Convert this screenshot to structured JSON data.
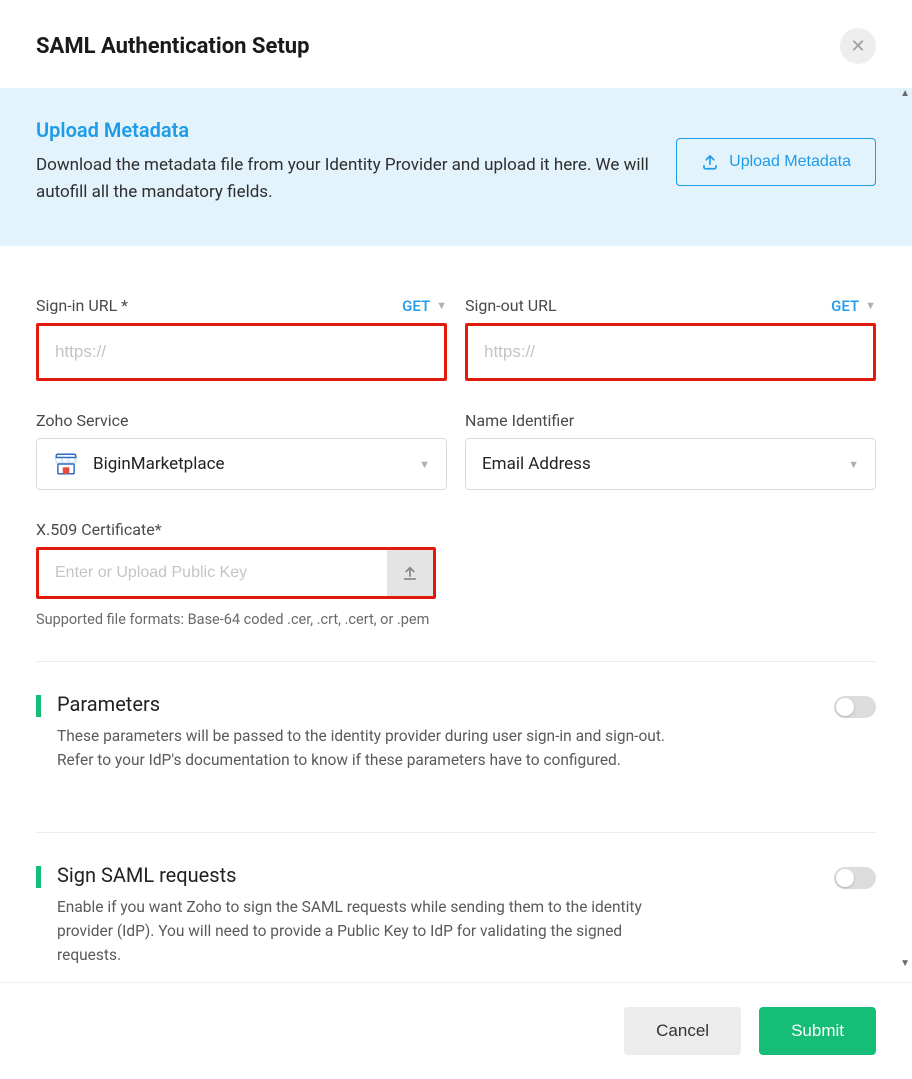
{
  "header": {
    "title": "SAML Authentication Setup"
  },
  "upload": {
    "heading": "Upload Metadata",
    "description": "Download the metadata file from your Identity Provider and upload it here. We will autofill all the mandatory fields.",
    "button_label": "Upload Metadata"
  },
  "fields": {
    "signin": {
      "label": "Sign-in URL *",
      "method": "GET",
      "placeholder": "https://"
    },
    "signout": {
      "label": "Sign-out URL",
      "method": "GET",
      "placeholder": "https://"
    },
    "zoho_service": {
      "label": "Zoho Service",
      "value": "BiginMarketplace"
    },
    "name_identifier": {
      "label": "Name Identifier",
      "value": "Email Address"
    },
    "certificate": {
      "label": "X.509 Certificate*",
      "placeholder": "Enter or Upload Public Key",
      "helper": "Supported file formats: Base-64 coded .cer, .crt, .cert, or .pem"
    }
  },
  "sections": {
    "parameters": {
      "title": "Parameters",
      "desc": "These parameters will be passed to the identity provider during user sign-in and sign-out. Refer to your IdP's documentation to know if these parameters have to configured."
    },
    "sign_saml": {
      "title": "Sign SAML requests",
      "desc": "Enable if you want Zoho to sign the SAML requests while sending them to the identity provider (IdP). You will need to provide a Public Key to IdP for validating the signed requests."
    }
  },
  "footer": {
    "cancel": "Cancel",
    "submit": "Submit"
  }
}
